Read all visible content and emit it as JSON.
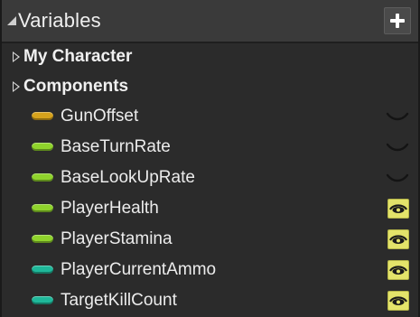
{
  "panel": {
    "title": "Variables",
    "add_button_icon": "plus-icon",
    "categories": [
      {
        "label": "My Character"
      },
      {
        "label": "Components"
      }
    ],
    "variables": [
      {
        "name": "GunOffset",
        "type_color": "#d6a21c",
        "visibility_icon": "eye-closed-icon",
        "visible": false
      },
      {
        "name": "BaseTurnRate",
        "type_color": "#8fd32c",
        "visibility_icon": "eye-closed-icon",
        "visible": false
      },
      {
        "name": "BaseLookUpRate",
        "type_color": "#8fd32c",
        "visibility_icon": "eye-closed-icon",
        "visible": false
      },
      {
        "name": "PlayerHealth",
        "type_color": "#8fd32c",
        "visibility_icon": "eye-open-icon",
        "visible": true
      },
      {
        "name": "PlayerStamina",
        "type_color": "#8fd32c",
        "visibility_icon": "eye-open-icon",
        "visible": true
      },
      {
        "name": "PlayerCurrentAmmo",
        "type_color": "#1fb89a",
        "visibility_icon": "eye-open-icon",
        "visible": true
      },
      {
        "name": "TargetKillCount",
        "type_color": "#1fb89a",
        "visibility_icon": "eye-open-icon",
        "visible": true
      }
    ]
  },
  "colors": {
    "background": "#2b2b2b",
    "header": "#3a3a3a",
    "eye_open_bg": "#e3e36a"
  }
}
